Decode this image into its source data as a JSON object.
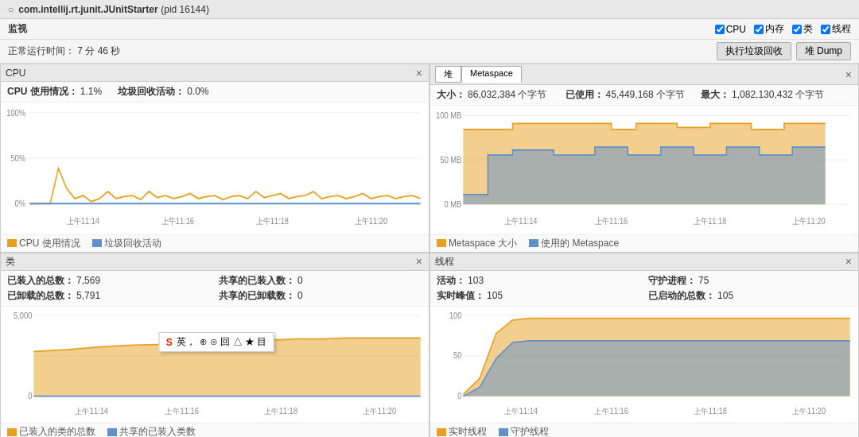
{
  "titleBar": {
    "icon": "○",
    "appTitle": "com.intellij.rt.junit.JUnitStarter",
    "pid": "(pid 16144)"
  },
  "monitorHeader": {
    "label": "监视",
    "checkboxes": [
      {
        "id": "cb-cpu",
        "label": "CPU",
        "checked": true
      },
      {
        "id": "cb-memory",
        "label": "内存",
        "checked": true
      },
      {
        "id": "cb-class",
        "label": "类",
        "checked": true
      },
      {
        "id": "cb-thread",
        "label": "线程",
        "checked": true
      }
    ]
  },
  "uptimeBar": {
    "label": "正常运行时间：",
    "value": "7 分 46 秒",
    "buttons": [
      {
        "label": "执行垃圾回收"
      },
      {
        "label": "堆 Dump"
      }
    ]
  },
  "panels": {
    "cpu": {
      "title": "CPU",
      "stats": [
        {
          "label": "CPU 使用情况：",
          "value": "1.1%"
        },
        {
          "label": "垃圾回收活动：",
          "value": "0.0%"
        }
      ],
      "yLabels": [
        "100%",
        "50%",
        "0%"
      ],
      "xLabels": [
        "上午11:14",
        "上午11:16",
        "上午11:18",
        "上午11:20"
      ],
      "legend": [
        {
          "color": "#e8a020",
          "label": "CPU 使用情况"
        },
        {
          "color": "#6090cc",
          "label": "垃圾回收活动"
        }
      ]
    },
    "heap": {
      "tabs": [
        "堆",
        "Metaspace"
      ],
      "activeTab": "Metaspace",
      "stats": [
        {
          "label": "大小：",
          "value": "86,032,384 个字节"
        },
        {
          "label": "已使用：",
          "value": "45,449,168 个字节"
        },
        {
          "label": "最大：",
          "value": "1,082,130,432 个字节"
        }
      ],
      "yLabels": [
        "100 MB",
        "50 MB",
        "0 MB"
      ],
      "xLabels": [
        "上午11:14",
        "上午11:16",
        "上午11:18",
        "上午11:20"
      ],
      "legend": [
        {
          "color": "#e8a020",
          "label": "Metaspace 大小"
        },
        {
          "color": "#6090cc",
          "label": "使用的 Metaspace"
        }
      ]
    },
    "classes": {
      "title": "类",
      "stats": [
        {
          "label": "已装入的总数：",
          "value": "7,569"
        },
        {
          "label": "共享的已装入数：",
          "value": "0"
        },
        {
          "label": "已卸载的总数：",
          "value": "5,791"
        },
        {
          "label": "共享的已卸载数：",
          "value": "0"
        }
      ],
      "yLabels": [
        "5,000",
        "0"
      ],
      "xLabels": [
        "上午11:14",
        "上午11:16",
        "上午11:18",
        "上午11:20"
      ],
      "legend": [
        {
          "color": "#e8a020",
          "label": "已装入的类的总数"
        },
        {
          "color": "#6090cc",
          "label": "共享的已装入类数"
        }
      ]
    },
    "threads": {
      "title": "线程",
      "stats": [
        {
          "label": "活动：",
          "value": "103"
        },
        {
          "label": "守护进程：",
          "value": "75"
        },
        {
          "label": "实时峰值：",
          "value": "105"
        },
        {
          "label": "已启动的总数：",
          "value": "105"
        }
      ],
      "yLabels": [
        "100",
        "50",
        "0"
      ],
      "xLabels": [
        "上午11:14",
        "上午11:16",
        "上午11:18",
        "上午11:20"
      ],
      "legend": [
        {
          "color": "#e8a020",
          "label": "实时线程"
        },
        {
          "color": "#6090cc",
          "label": "守护线程"
        }
      ]
    }
  },
  "tooltip": {
    "icon": "S",
    "text": "英",
    "items": [
      "⊕",
      "⊙",
      "回",
      "△",
      "★",
      "目"
    ]
  }
}
